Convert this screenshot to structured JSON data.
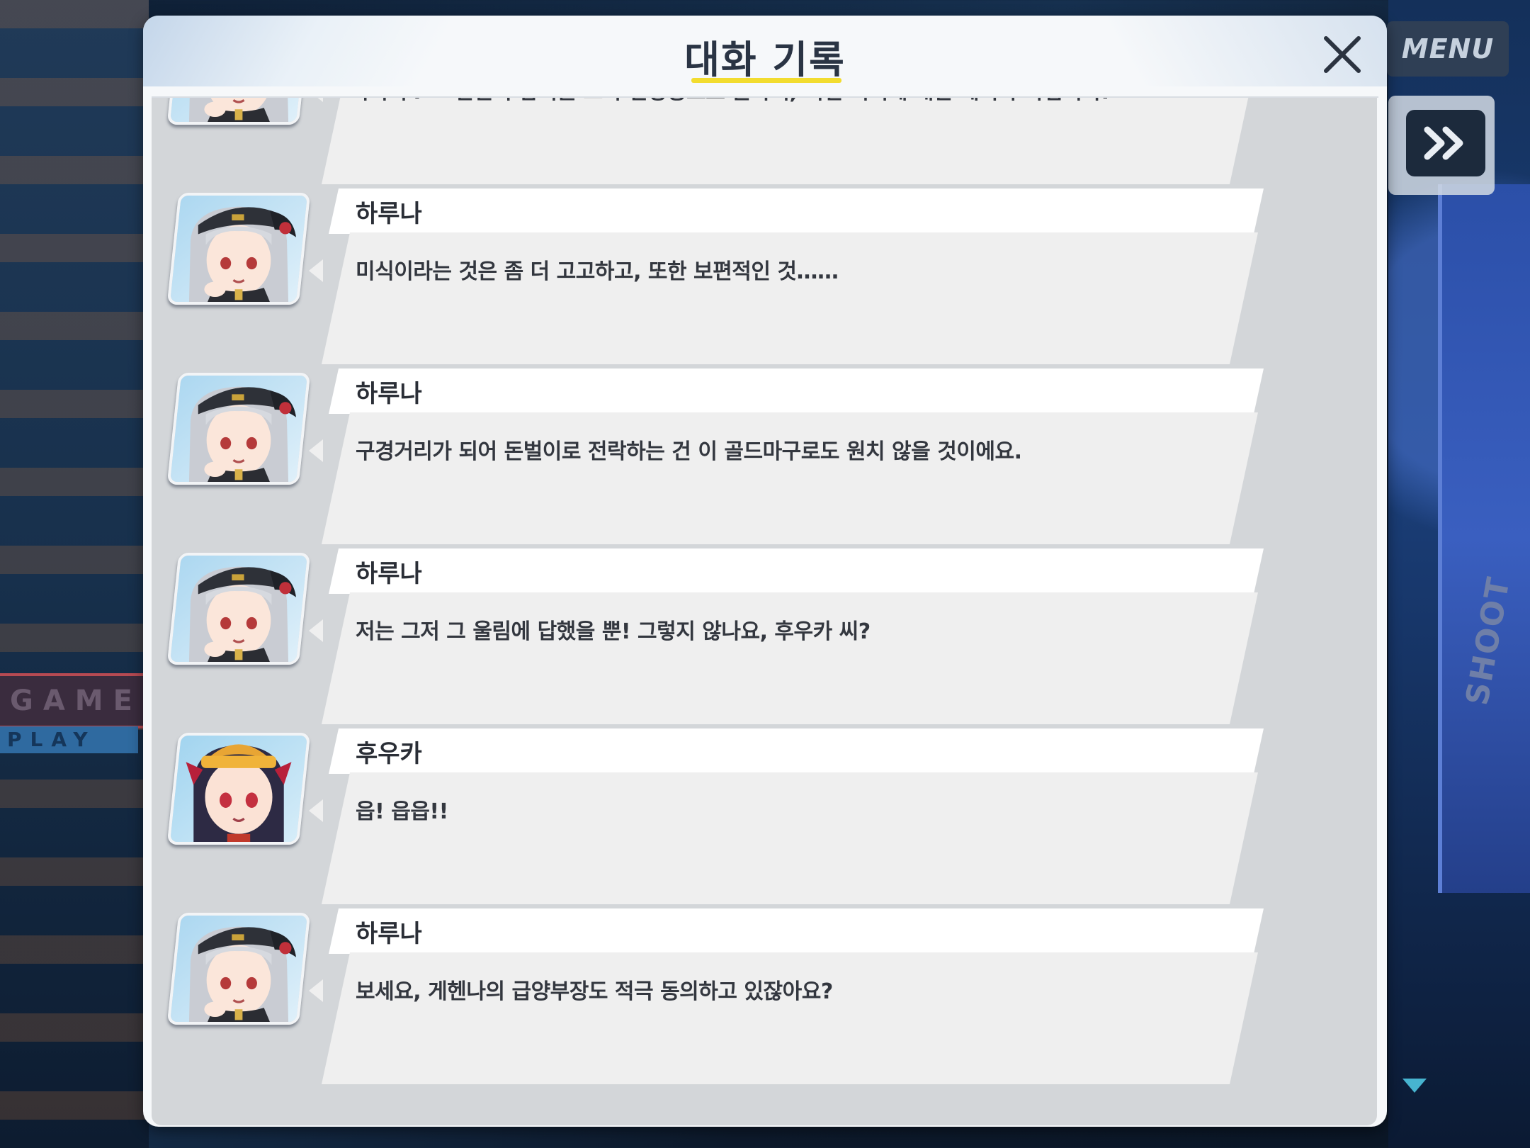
{
  "window": {
    "title": "대화 기록"
  },
  "controls": {
    "menu_label": "MENU",
    "close_icon": "close-icon",
    "skip_icon": "fast-forward-icon"
  },
  "background": {
    "sign_left": "GAMES",
    "sign_left2": "PLAY",
    "sign_right": "SHOOT"
  },
  "colors": {
    "accent_underline": "#f2dc2f",
    "scroll_arrow": "#47b4d0",
    "panel": "#f6f8fa",
    "log_bg": "#d3d6d9"
  },
  "log": [
    {
      "speaker": "",
      "avatar": "haruna-portrait",
      "text": "후후후. 그 전설의 참치를 고작 관상용으로 둔다니, 이건 미식에 대한 예의가 아닙니다."
    },
    {
      "speaker": "하루나",
      "avatar": "haruna-portrait",
      "text": "미식이라는 것은 좀 더 고고하고, 또한 보편적인 것……"
    },
    {
      "speaker": "하루나",
      "avatar": "haruna-portrait",
      "text": "구경거리가 되어 돈벌이로 전락하는 건 이 골드마구로도 원치 않을 것이에요."
    },
    {
      "speaker": "하루나",
      "avatar": "haruna-portrait",
      "text": "저는 그저 그 울림에 답했을 뿐! 그렇지 않나요, 후우카 씨?"
    },
    {
      "speaker": "후우카",
      "avatar": "fuuka-portrait",
      "text": "읍! 읍읍!!"
    },
    {
      "speaker": "하루나",
      "avatar": "haruna-portrait",
      "text": "보세요, 게헨나의 급양부장도 적극 동의하고 있잖아요?"
    }
  ]
}
